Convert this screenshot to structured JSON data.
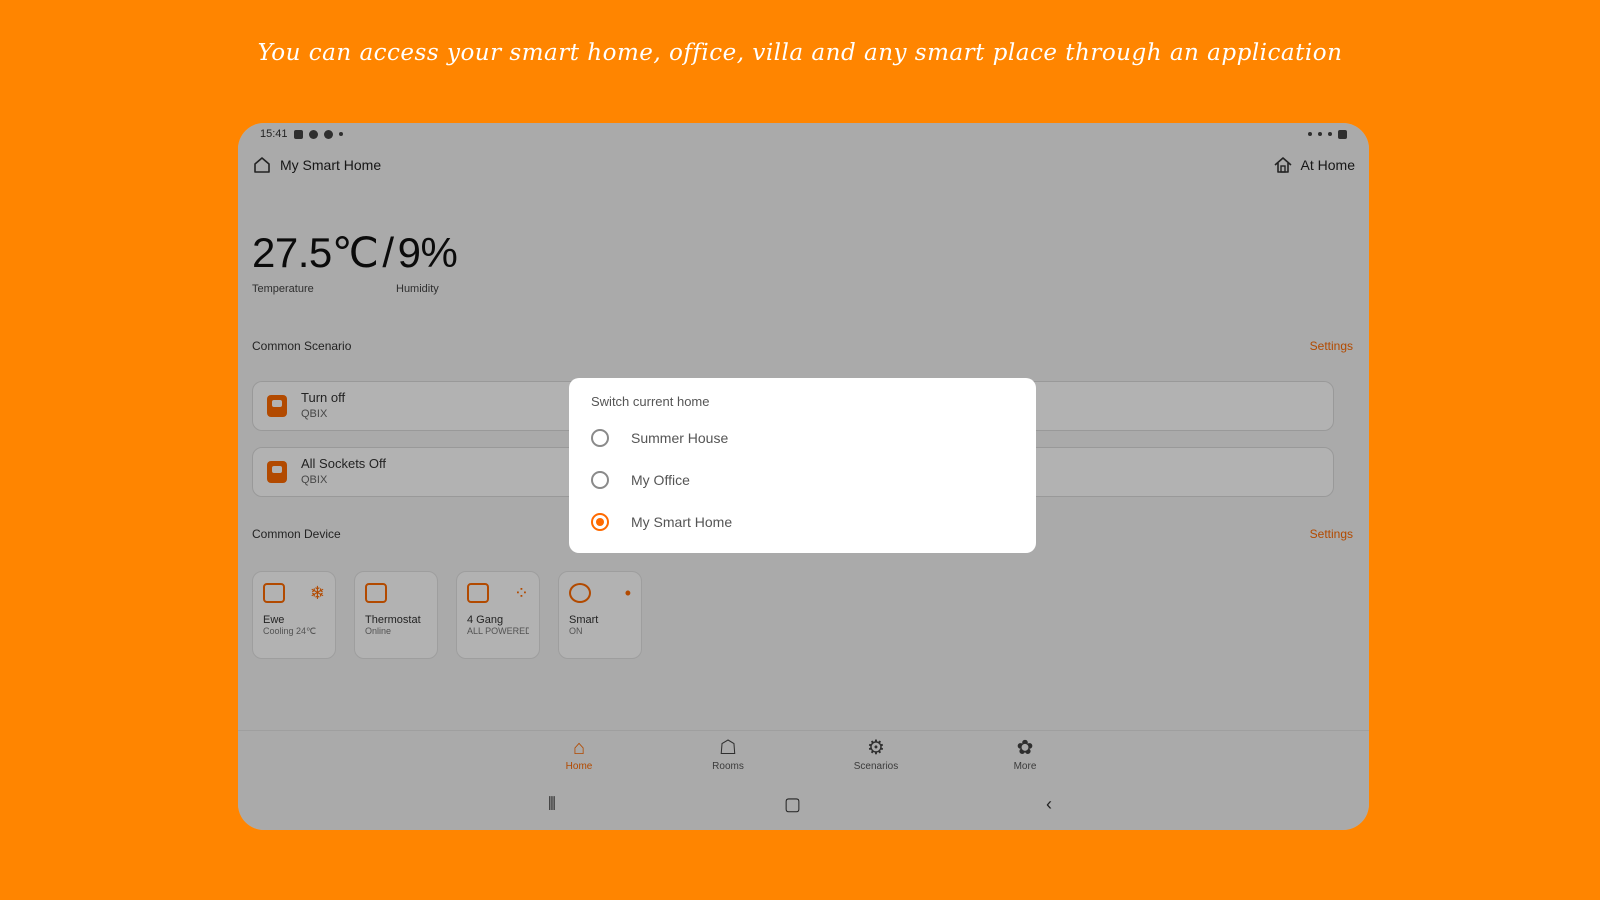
{
  "promo_text": "You can access your smart home, office, villa and any smart place through an application",
  "status_bar": {
    "time": "15:41",
    "left_icons": [
      "image-icon",
      "settings-icon",
      "settings-icon",
      "dot-icon"
    ],
    "right_icons": [
      "mute-icon",
      "wifi-icon",
      "signal-icon",
      "battery-icon"
    ]
  },
  "header": {
    "home_name": "My Smart Home",
    "home_icon": "home-icon",
    "presence_label": "At Home",
    "presence_icon": "home-presence-icon"
  },
  "climate": {
    "temperature": "27.5℃",
    "separator": "/",
    "humidity": "9%",
    "temperature_label": "Temperature",
    "humidity_label": "Humidity"
  },
  "scenarios": {
    "title": "Common Scenario",
    "settings_label": "Settings",
    "items": [
      {
        "name": "Turn off",
        "sub": "QBIX"
      },
      {
        "name": "All Sockets Off",
        "sub": "QBIX"
      }
    ]
  },
  "devices": {
    "title": "Common Device",
    "settings_label": "Settings",
    "items": [
      {
        "name": "Ewe",
        "sub": "Cooling 24℃",
        "icon": "ac-icon",
        "action_icon": "snowflake-icon"
      },
      {
        "name": "Thermostat",
        "sub": "Online",
        "icon": "thermostat-icon",
        "action_icon": ""
      },
      {
        "name": "4 Gang",
        "sub": "ALL POWERED",
        "icon": "switch-icon",
        "action_icon": "grid-icon"
      },
      {
        "name": "Smart",
        "sub": "ON",
        "icon": "plug-icon",
        "action_icon": "dot-icon"
      }
    ]
  },
  "bottom_nav": {
    "items": [
      {
        "label": "Home",
        "icon": "home-icon",
        "active": true
      },
      {
        "label": "Rooms",
        "icon": "rooms-icon",
        "active": false
      },
      {
        "label": "Scenarios",
        "icon": "scenarios-icon",
        "active": false
      },
      {
        "label": "More",
        "icon": "more-icon",
        "active": false
      }
    ]
  },
  "dialog": {
    "title": "Switch current home",
    "options": [
      {
        "label": "Summer House",
        "selected": false
      },
      {
        "label": "My Office",
        "selected": false
      },
      {
        "label": "My Smart Home",
        "selected": true
      }
    ]
  },
  "colors": {
    "background": "#ff8500",
    "accent": "#ff6a00",
    "overlay": "rgba(0,0,0,0.30)"
  }
}
